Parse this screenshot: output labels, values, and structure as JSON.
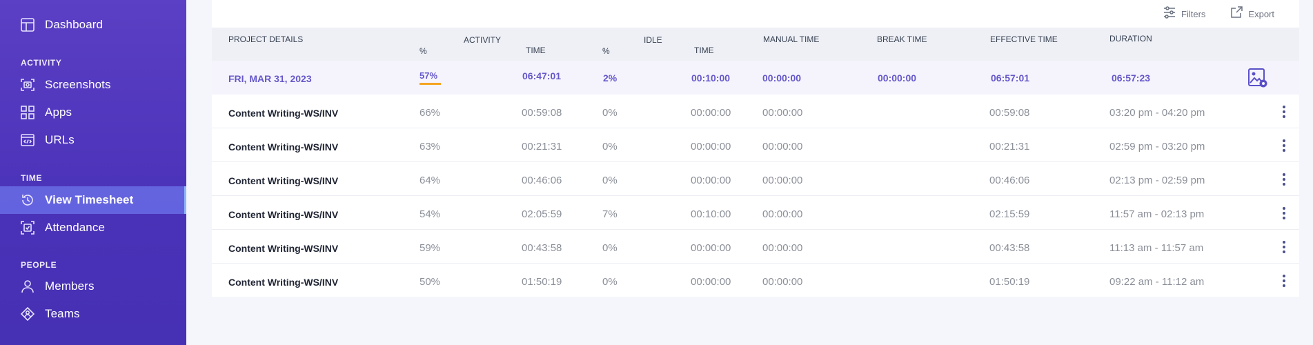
{
  "sidebar": {
    "items": [
      {
        "label": "Dashboard",
        "icon": "dashboard-icon"
      },
      {
        "label": "Screenshots",
        "icon": "screenshot-icon"
      },
      {
        "label": "Apps",
        "icon": "apps-grid-icon"
      },
      {
        "label": "URLs",
        "icon": "url-browser-icon"
      },
      {
        "label": "View Timesheet",
        "icon": "timesheet-clock-icon",
        "active": true
      },
      {
        "label": "Attendance",
        "icon": "attendance-icon"
      },
      {
        "label": "Members",
        "icon": "member-icon"
      },
      {
        "label": "Teams",
        "icon": "teams-icon"
      }
    ],
    "sections": {
      "activity": "ACTIVITY",
      "time": "TIME",
      "people": "PEOPLE"
    }
  },
  "toolbar": {
    "filters_label": "Filters",
    "export_label": "Export"
  },
  "table": {
    "headers": {
      "project_details": "PROJECT DETAILS",
      "activity": "ACTIVITY",
      "activity_pct": "%",
      "activity_time": "TIME",
      "idle": "IDLE",
      "idle_pct": "%",
      "idle_time": "TIME",
      "manual_time": "MANUAL TIME",
      "break_time": "BREAK TIME",
      "effective_time": "EFFECTIVE TIME",
      "duration": "DURATION"
    },
    "date_row": {
      "date": "FRI, MAR 31, 2023",
      "activity_pct": "57%",
      "activity_time": "06:47:01",
      "idle_pct": "2%",
      "idle_time": "00:10:00",
      "manual_time": "00:00:00",
      "break_time": "00:00:00",
      "effective_time": "06:57:01",
      "duration": "06:57:23"
    },
    "rows": [
      {
        "project": "Content Writing-WS/INV",
        "activity_pct": "66%",
        "activity_time": "00:59:08",
        "idle_pct": "0%",
        "idle_time": "00:00:00",
        "manual_time": "00:00:00",
        "effective_time": "00:59:08",
        "duration": "03:20 pm - 04:20 pm"
      },
      {
        "project": "Content Writing-WS/INV",
        "activity_pct": "63%",
        "activity_time": "00:21:31",
        "idle_pct": "0%",
        "idle_time": "00:00:00",
        "manual_time": "00:00:00",
        "effective_time": "00:21:31",
        "duration": "02:59 pm - 03:20 pm"
      },
      {
        "project": "Content Writing-WS/INV",
        "activity_pct": "64%",
        "activity_time": "00:46:06",
        "idle_pct": "0%",
        "idle_time": "00:00:00",
        "manual_time": "00:00:00",
        "effective_time": "00:46:06",
        "duration": "02:13 pm - 02:59 pm"
      },
      {
        "project": "Content Writing-WS/INV",
        "activity_pct": "54%",
        "activity_time": "02:05:59",
        "idle_pct": "7%",
        "idle_time": "00:10:00",
        "manual_time": "00:00:00",
        "effective_time": "02:15:59",
        "duration": "11:57 am - 02:13 pm"
      },
      {
        "project": "Content Writing-WS/INV",
        "activity_pct": "59%",
        "activity_time": "00:43:58",
        "idle_pct": "0%",
        "idle_time": "00:00:00",
        "manual_time": "00:00:00",
        "effective_time": "00:43:58",
        "duration": "11:13 am - 11:57 am"
      },
      {
        "project": "Content Writing-WS/INV",
        "activity_pct": "50%",
        "activity_time": "01:50:19",
        "idle_pct": "0%",
        "idle_time": "00:00:00",
        "manual_time": "00:00:00",
        "effective_time": "01:50:19",
        "duration": "09:22 am - 11:12 am"
      }
    ]
  },
  "colors": {
    "sidebar_bg": "#5b3fc4",
    "active_nav": "#7a8cff",
    "date_row_text": "#6558c9",
    "activity_underline": "#f4a422"
  }
}
